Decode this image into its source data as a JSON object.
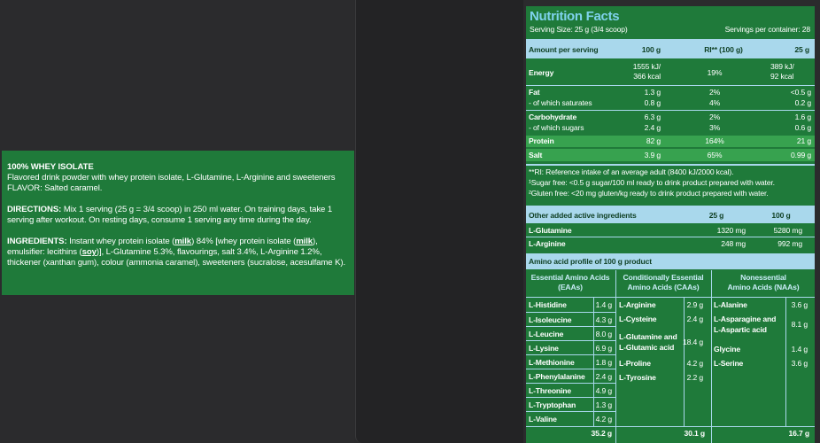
{
  "description": {
    "title": "100% WHEY ISOLATE",
    "line1": "Flavored drink powder with whey protein isolate, L-Glutamine, L-Arginine and sweeteners",
    "flavor": "FLAVOR: Salted caramel.",
    "directions_label": "DIRECTIONS:",
    "directions_l1": " Mix 1 serving (25 g = 3/4 scoop) in 250 ml water. On training days, take 1",
    "directions_l2": "serving after workout. On resting days, consume 1 serving any time during the day.",
    "ingredients_label": "INGREDIENTS:",
    "ing_a": " Instant whey protein isolate (",
    "ing_milk1": "milk",
    "ing_b": ") 84% [whey protein isolate (",
    "ing_milk2": "milk",
    "ing_c": "),",
    "ing_l2a": "emulsifier: lecithins (",
    "ing_soy": "soy",
    "ing_l2b": ")], L-Glutamine 5.3%, flavourings, salt 3.4%, L-Arginine 1.2%,",
    "ing_l3": "thickener (xanthan gum), colour (ammonia caramel), sweeteners (sucralose, acesulfame K)."
  },
  "nutrition": {
    "title": "Nutrition Facts",
    "serving_size": "Serving Size: 25 g (3/4 scoop)",
    "servings_per_container": "Servings per container: 28",
    "header": {
      "label": "Amount per serving",
      "col1": "100 g",
      "col2": "RI** (100 g)",
      "col3": "25 g"
    },
    "energy": {
      "label": "Energy",
      "v1a": "1555 kJ/",
      "v1b": "366 kcal",
      "ri": "19%",
      "v3a": "389 kJ/",
      "v3b": "92 kcal"
    },
    "fat": {
      "label": "Fat",
      "v1": "1.3 g",
      "ri": "2%",
      "v3": "<0.5 g"
    },
    "saturates": {
      "label": "- of which saturates",
      "v1": "0.8 g",
      "ri": "4%",
      "v3": "0.2 g"
    },
    "carbohydrate": {
      "label": "Carbohydrate",
      "v1": "6.3 g",
      "ri": "2%",
      "v3": "1.6 g"
    },
    "sugars": {
      "label": "- of which sugars",
      "v1": "2.4 g",
      "ri": "3%",
      "v3": "0.6 g"
    },
    "protein": {
      "label": "Protein",
      "v1": "82 g",
      "ri": "164%",
      "v3": "21 g"
    },
    "salt": {
      "label": "Salt",
      "v1": "3.9 g",
      "ri": "65%",
      "v3": "0.99 g"
    },
    "footnote1": "**RI: Reference intake of an average adult (8400 kJ/2000 kcal).",
    "footnote2": "¹Sugar free: <0.5 g sugar/100 ml ready to drink product prepared with water.",
    "footnote3": "²Gluten free: <20 mg gluten/kg ready to drink product prepared with water.",
    "other_header": {
      "label": "Other added active ingredients",
      "col1": "25 g",
      "col2": "100 g"
    },
    "glutamine": {
      "label": "L-Glutamine",
      "v1": "1320 mg",
      "v2": "5280 mg"
    },
    "arginine": {
      "label": "L-Arginine",
      "v1": "248 mg",
      "v2": "992 mg"
    },
    "amino_title": "Amino acid profile of 100 g product",
    "amino_headers": {
      "eaa_1": "Essential Amino Acids",
      "eaa_2": "(EAAs)",
      "caa_1": "Conditionally Essential",
      "caa_2": "Amino Acids (CAAs)",
      "naa_1": "Nonessential",
      "naa_2": "Amino Acids (NAAs)"
    },
    "eaa": [
      {
        "name": "L-Histidine",
        "value": "1.4 g"
      },
      {
        "name": "L-Isoleucine",
        "value": "4.3 g"
      },
      {
        "name": "L-Leucine",
        "value": "8.0 g"
      },
      {
        "name": "L-Lysine",
        "value": "6.9 g"
      },
      {
        "name": "L-Methionine",
        "value": "1.8 g"
      },
      {
        "name": "L-Phenylalanine",
        "value": "2.4 g"
      },
      {
        "name": "L-Threonine",
        "value": "4.9 g"
      },
      {
        "name": "L-Tryptophan",
        "value": "1.3 g"
      },
      {
        "name": "L-Valine",
        "value": "4.2 g"
      }
    ],
    "caa": {
      "arginine": {
        "name": "L-Arginine",
        "value": "2.9 g"
      },
      "cysteine": {
        "name": "L-Cysteine",
        "value": "2.4 g"
      },
      "glutamine_1": "L-Glutamine and",
      "glutamine_2": "L-Glutamic acid",
      "glutamine_value": "18.4 g",
      "proline": {
        "name": "L-Proline",
        "value": "4.2 g"
      },
      "tyrosine": {
        "name": "L-Tyrosine",
        "value": "2.2 g"
      }
    },
    "naa": {
      "alanine": {
        "name": "L-Alanine",
        "value": "3.6 g"
      },
      "asparagine_1": "L-Asparagine and",
      "asparagine_2": "L-Aspartic acid",
      "asparagine_value": "8.1 g",
      "glycine": {
        "name": "Glycine",
        "value": "1.4 g"
      },
      "serine": {
        "name": "L-Serine",
        "value": "3.6 g"
      }
    },
    "totals": {
      "eaa": "35.2 g",
      "caa": "30.1 g",
      "naa": "16.7 g"
    }
  }
}
